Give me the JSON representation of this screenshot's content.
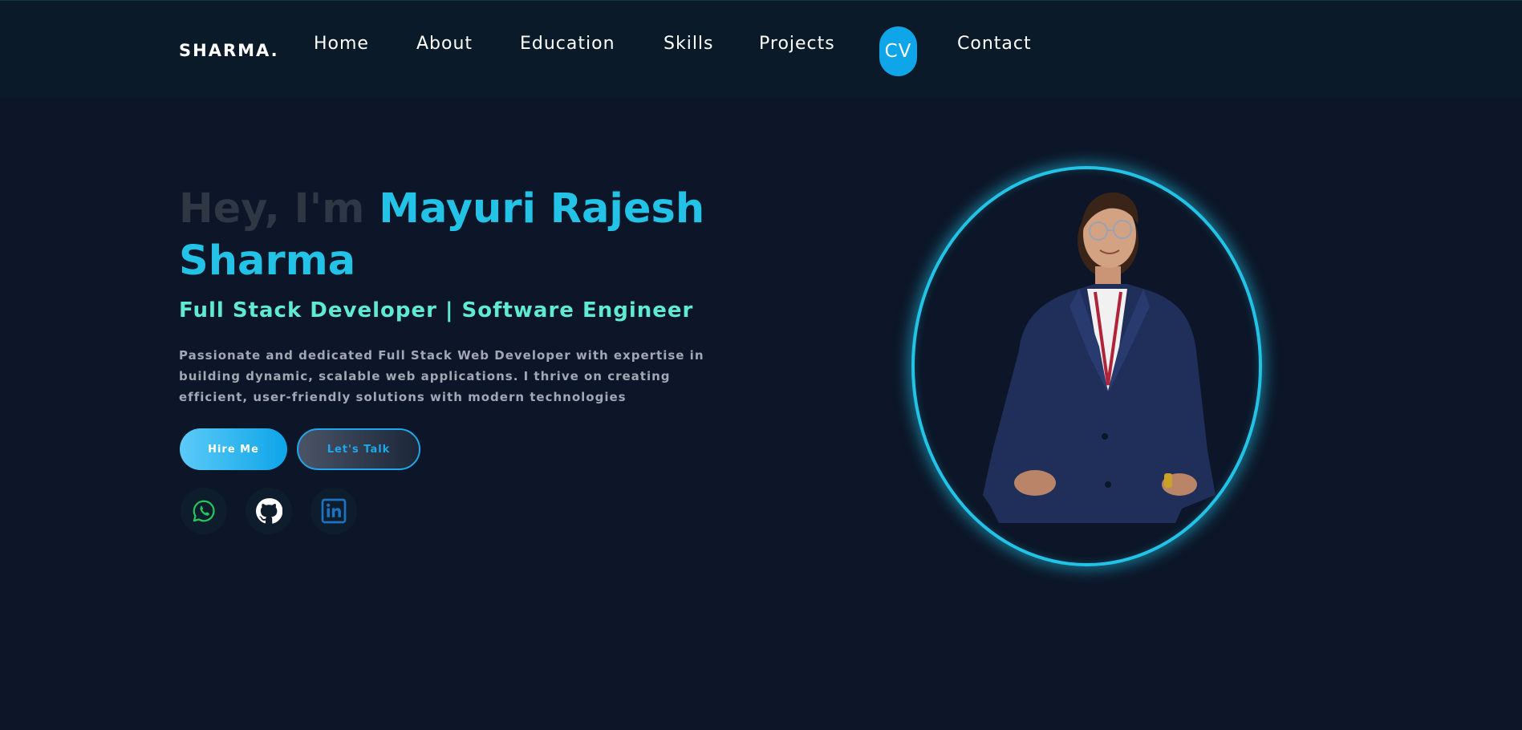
{
  "nav": {
    "logo": "SHARMA.",
    "links": [
      "Home",
      "About",
      "Education",
      "Skills",
      "Projects",
      "Contact"
    ],
    "cv_label": "CV"
  },
  "hero": {
    "greeting": "Hey, I'm ",
    "name_line1": "Mayuri Rajesh",
    "name_line2": "Sharma",
    "subtitle": "Full Stack Developer | Software Engineer",
    "description": "Passionate and dedicated Full Stack Web Developer with expertise in building dynamic, scalable web applications. I thrive on creating efficient, user-friendly solutions with modern technologies",
    "hire_label": "Hire Me",
    "talk_label": "Let's Talk"
  },
  "social": {
    "icons": [
      "whatsapp-icon",
      "github-icon",
      "linkedin-icon"
    ]
  },
  "colors": {
    "background": "#0c1628",
    "accent": "#22c3e6",
    "subtitle": "#5eead4",
    "cv_button": "#0ea5e9"
  }
}
